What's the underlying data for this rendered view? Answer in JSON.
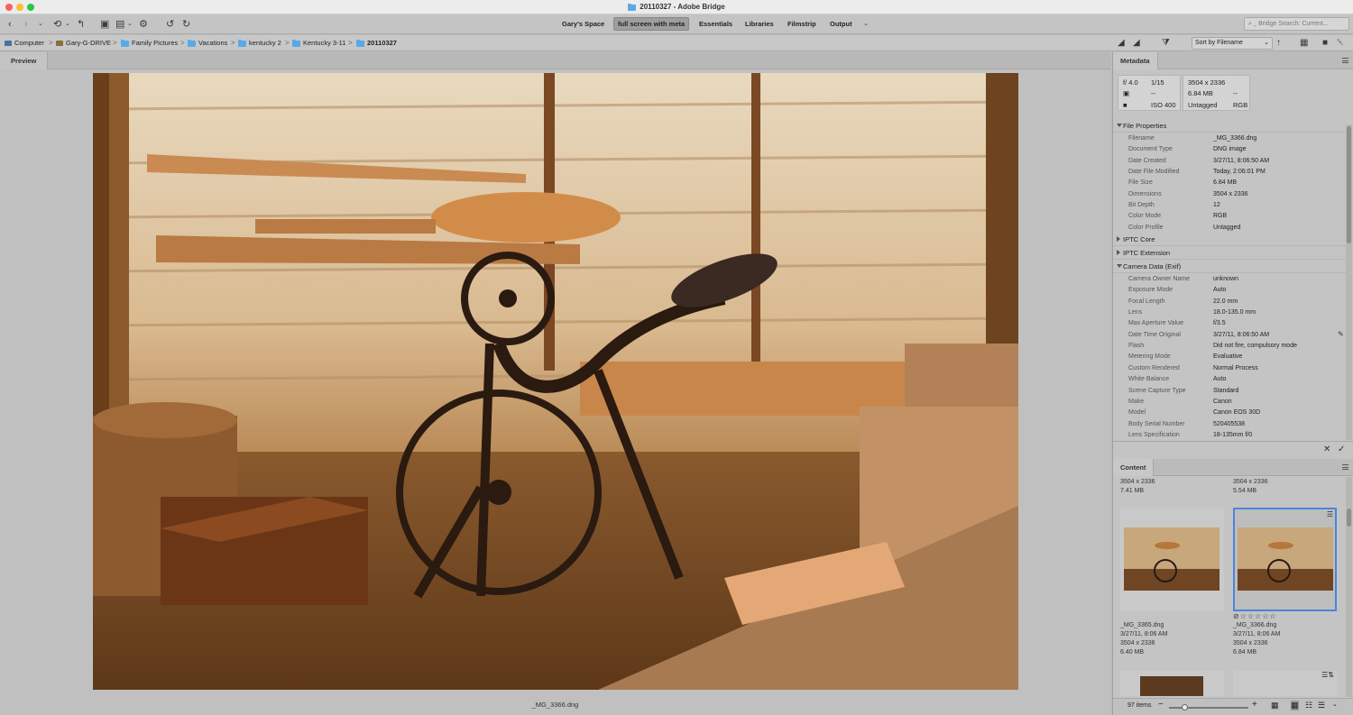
{
  "window": {
    "title": "20110327 - Adobe Bridge"
  },
  "workspaces": [
    "Gary's Space",
    "full screen with meta",
    "Essentials",
    "Libraries",
    "Filmstrip",
    "Output"
  ],
  "workspace_menu_icon": "chevron-down-icon",
  "search": {
    "placeholder": "Bridge Search: Current..."
  },
  "breadcrumb": [
    "Computer",
    "Gary-G-DRIVE",
    "Family Pictures",
    "Vacations",
    "kentucky 2",
    "Kentucky 3-11",
    "20110327"
  ],
  "sort": {
    "label": "Sort by Filename"
  },
  "preview": {
    "tab": "Preview",
    "filename": "_MG_3366.dng"
  },
  "metadata": {
    "tab": "Metadata",
    "camera": {
      "aperture": "f/ 4.0",
      "shutter": "1/15",
      "metering": "--",
      "iso": "ISO 400",
      "dims": "3504 x 2336",
      "size": "6.84 MB",
      "size2": "--",
      "profile": "Untagged",
      "mode": "RGB"
    },
    "file_properties_title": "File Properties",
    "file_properties": [
      {
        "k": "Filename",
        "v": "_MG_3366.dng"
      },
      {
        "k": "Document Type",
        "v": "DNG image"
      },
      {
        "k": "Date Created",
        "v": "3/27/11, 8:06:50 AM"
      },
      {
        "k": "Date File Modified",
        "v": "Today, 2:06:01 PM"
      },
      {
        "k": "File Size",
        "v": "6.84 MB"
      },
      {
        "k": "Dimensions",
        "v": "3504 x 2336"
      },
      {
        "k": "Bit Depth",
        "v": "12"
      },
      {
        "k": "Color Mode",
        "v": "RGB"
      },
      {
        "k": "Color Profile",
        "v": "Untagged"
      }
    ],
    "iptc_core": "IPTC Core",
    "iptc_extension": "IPTC Extension",
    "camera_data_title": "Camera Data (Exif)",
    "camera_data": [
      {
        "k": "Camera Owner Name",
        "v": "unknown"
      },
      {
        "k": "Exposure Mode",
        "v": "Auto"
      },
      {
        "k": "Focal Length",
        "v": "22.0 mm"
      },
      {
        "k": "Lens",
        "v": "18.0-135.0 mm"
      },
      {
        "k": "Max Aperture Value",
        "v": "f/3.5"
      },
      {
        "k": "Date Time Original",
        "v": "3/27/11, 8:06:50 AM"
      },
      {
        "k": "Flash",
        "v": "Did not fire, compulsory mode"
      },
      {
        "k": "Metering Mode",
        "v": "Evaluative"
      },
      {
        "k": "Custom Rendered",
        "v": "Normal Process"
      },
      {
        "k": "White Balance",
        "v": "Auto"
      },
      {
        "k": "Scene Capture Type",
        "v": "Standard"
      },
      {
        "k": "Make",
        "v": "Canon"
      },
      {
        "k": "Model",
        "v": "Canon EOS 30D"
      },
      {
        "k": "Body Serial Number",
        "v": "520405538"
      },
      {
        "k": "Lens Specification",
        "v": "18-135mm f/0"
      }
    ]
  },
  "content": {
    "tab": "Content",
    "top_row": [
      {
        "dims": "3504 x 2336",
        "size": "7.41 MB"
      },
      {
        "dims": "3504 x 2336",
        "size": "5.54 MB"
      }
    ],
    "items": [
      {
        "name": "_MG_3365.dng",
        "date": "3/27/11, 8:06 AM",
        "dims": "3504 x 2336",
        "size": "6.40 MB",
        "selected": false
      },
      {
        "name": "_MG_3366.dng",
        "date": "3/27/11, 8:06 AM",
        "dims": "3504 x 2336",
        "size": "6.84 MB",
        "selected": true,
        "rating_stars": 0
      }
    ],
    "count": "97 items"
  }
}
